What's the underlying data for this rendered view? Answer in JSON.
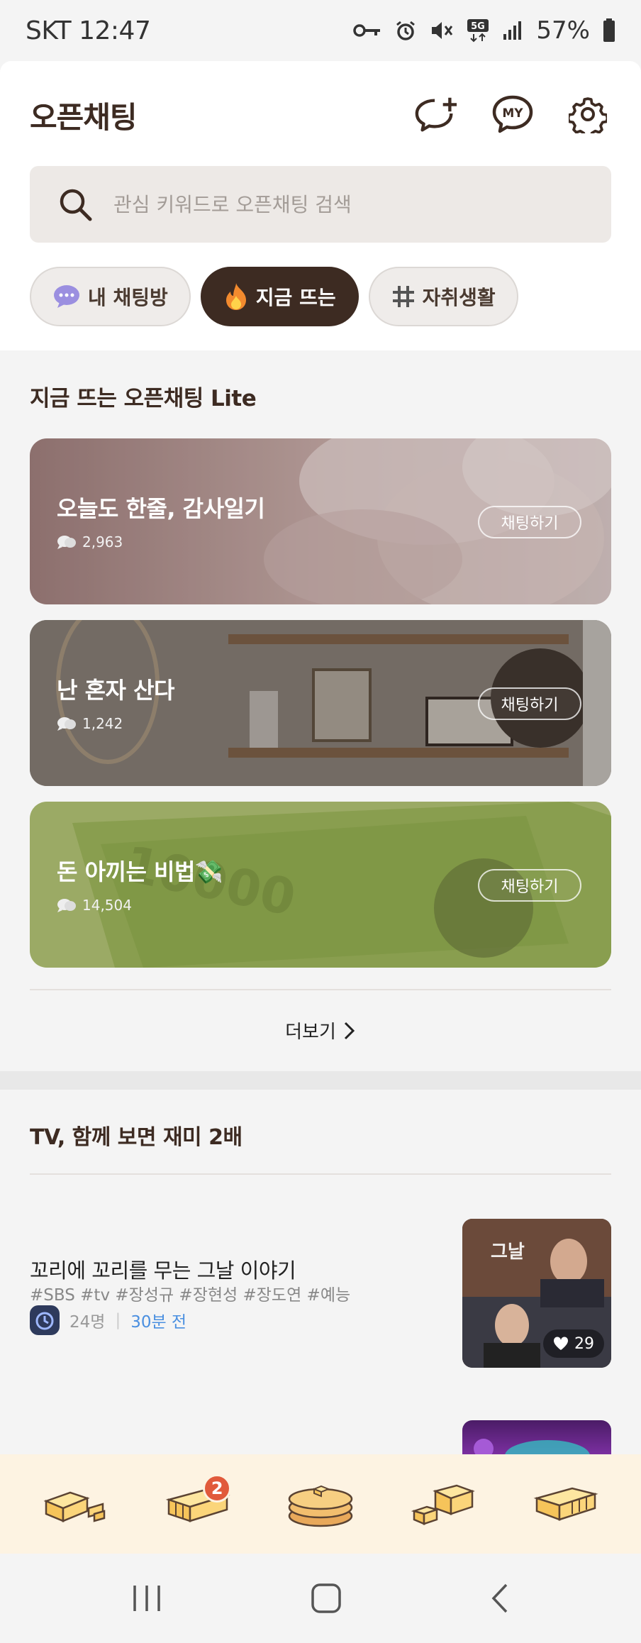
{
  "status": {
    "carrier_time": "SKT 12:47",
    "battery": "57%"
  },
  "header": {
    "title": "오픈채팅",
    "icons": [
      "add-friend-chat-icon",
      "my-chat-icon",
      "settings-gear-icon"
    ],
    "my_icon_text": "MY"
  },
  "search": {
    "placeholder": "관심 키워드로 오픈채팅 검색"
  },
  "chips": [
    {
      "label": "내 채팅방",
      "icon": "chat-bubble-emoji"
    },
    {
      "label": "지금 뜨는",
      "icon": "fire-emoji",
      "active": true
    },
    {
      "label": "자취생활",
      "icon": "hash-icon"
    }
  ],
  "lite_section": {
    "title": "지금 뜨는 오픈채팅 Lite",
    "cards": [
      {
        "title": "오늘도 한줄, 감사일기",
        "count": "2,963",
        "button": "채팅하기",
        "color": "#a88a87"
      },
      {
        "title": "난 혼자 산다",
        "count": "1,242",
        "button": "채팅하기",
        "color": "#7c736a"
      },
      {
        "title": "돈 아끼는 비법💸",
        "count": "14,504",
        "button": "채팅하기",
        "color": "#9fb25a"
      }
    ],
    "more_label": "더보기"
  },
  "tv_section": {
    "title": "TV, 함께 보면 재미 2배",
    "item": {
      "title": "꼬리에 꼬리를 무는 그날 이야기",
      "tags": "#SBS #tv #장성규 #장현성 #장도연 #예능",
      "members": "24명",
      "time": "30분 전",
      "likes": "29"
    }
  },
  "bottom_nav": {
    "items": [
      "butter-block-icon",
      "butter-slices-icon",
      "pancake-icon",
      "butter-cubes-icon",
      "bread-loaf-icon"
    ],
    "badge": "2"
  },
  "colors": {
    "accent": "#3d2b22",
    "link": "#4a8fe0",
    "badge": "#e15a3b",
    "nav_bg": "#fdf3e2"
  }
}
